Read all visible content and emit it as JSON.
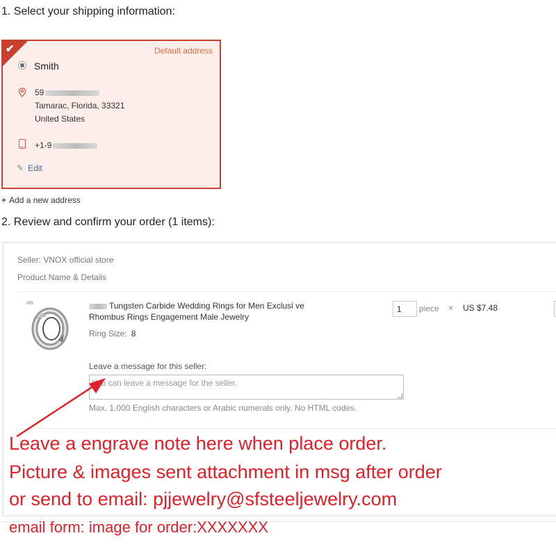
{
  "step1": {
    "heading": "1. Select your shipping information:"
  },
  "address_card": {
    "default_label": "Default address",
    "name": "Smith",
    "street_prefix": "59",
    "city_line": "Tamarac, Florida, 33321",
    "country": "United States",
    "phone_prefix": "+1-9",
    "edit_label": "Edit"
  },
  "add_address_label": "Add a new address",
  "step2": {
    "heading": "2. Review and confirm your order (1 items):"
  },
  "order": {
    "seller": "Seller: VNOX official store",
    "product_header": "Product Name & Details",
    "product_title": "Tungsten Carbide Wedding Rings for Men Exclusi ve Rhombus Rings Engagement Male Jewelry",
    "ring_size_label": "Ring Size:",
    "ring_size_value": "8",
    "quantity": "1",
    "unit": "piece",
    "times": "×",
    "price": "US $7.48",
    "message_label": "Leave a message for this seller:",
    "message_placeholder": "You can leave a message for the seller.",
    "message_hint": "Max. 1,000 English characters or Arabic numerals only. No HTML codes."
  },
  "annotation": {
    "line1": "Leave a engrave note here when place order.",
    "line2": "Picture & images sent attachment in msg after order",
    "line3": "or send to email: pjjewelry@sfsteeljewelry.com",
    "line4": "email form: image for order:XXXXXXX",
    "color": "#e0202a"
  },
  "colors": {
    "accent": "#c8402f",
    "card_bg": "#fdeeea",
    "link": "#3b6cb6"
  }
}
